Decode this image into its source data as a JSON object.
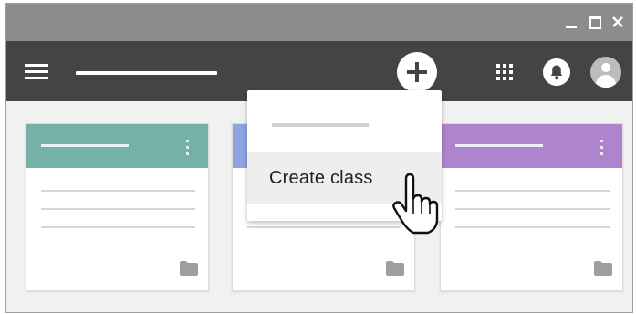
{
  "window_controls": {
    "minimize_icon": "minimize-icon",
    "maximize_icon": "maximize-icon",
    "close_icon": "close-icon"
  },
  "appbar": {
    "icons": [
      "hamburger-menu-icon",
      "plus-icon",
      "apps-grid-icon",
      "notification-bell-icon",
      "account-avatar-icon"
    ],
    "background": "#444444"
  },
  "cards": [
    {
      "header_color": "#75b1a6",
      "icon": "folder-icon"
    },
    {
      "header_color": "#8ea3e0",
      "icon": "folder-icon"
    },
    {
      "header_color": "#ae84cc",
      "icon": "folder-icon"
    }
  ],
  "menu": {
    "items": [
      {
        "label": "Create class",
        "highlighted": true
      }
    ]
  },
  "cursor": "hand-pointer-icon"
}
